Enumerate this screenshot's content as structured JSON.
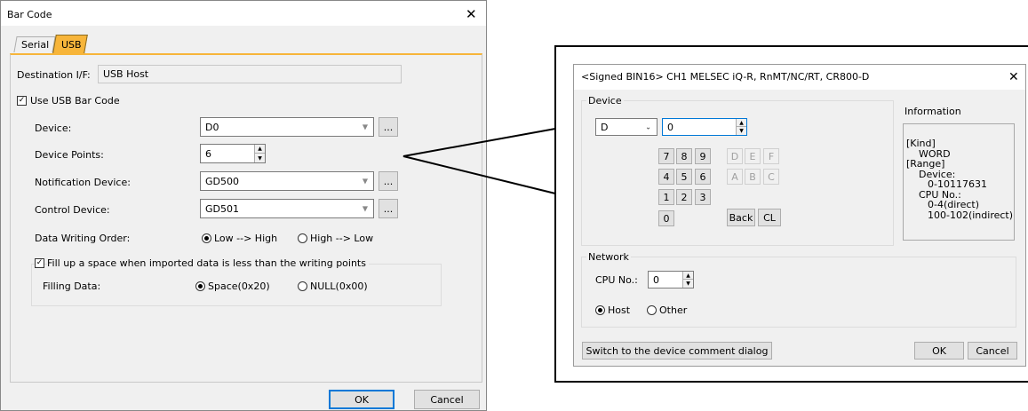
{
  "barcode_dialog": {
    "title": "Bar Code",
    "close_glyph": "✕",
    "tabs": [
      {
        "label": "Serial"
      },
      {
        "label": "USB"
      }
    ],
    "destination_label": "Destination I/F:",
    "destination_value": "USB Host",
    "use_usb_label": "Use USB Bar Code",
    "device_label": "Device:",
    "device_value": "D0",
    "device_points_label": "Device Points:",
    "device_points_value": "6",
    "notification_label": "Notification Device:",
    "notification_value": "GD500",
    "control_label": "Control Device:",
    "control_value": "GD501",
    "browse_label": "...",
    "order_label": "Data Writing Order:",
    "order_low_high": "Low --> High",
    "order_high_low": "High --> Low",
    "fill_label": "Fill up a space when imported data is less than the writing points",
    "filling_data_label": "Filling Data:",
    "fill_space": "Space(0x20)",
    "fill_null": "NULL(0x00)",
    "ok_label": "OK",
    "cancel_label": "Cancel"
  },
  "device_dialog": {
    "title": "<Signed BIN16> CH1 MELSEC iQ-R, RnMT/NC/RT, CR800-D",
    "close_glyph": "✕",
    "device_group": "Device",
    "device_type": "D",
    "device_number": "0",
    "keys_digits": [
      "7",
      "8",
      "9",
      "4",
      "5",
      "6",
      "1",
      "2",
      "3",
      "0"
    ],
    "keys_hex": [
      "D",
      "E",
      "F",
      "A",
      "B",
      "C"
    ],
    "back_label": "Back",
    "cl_label": "CL",
    "information_label": "Information",
    "info_lines": [
      "[Kind]",
      "WORD",
      "[Range]",
      "Device:",
      "0-10117631",
      "CPU No.:",
      "0-4(direct)",
      "100-102(indirect)"
    ],
    "network_group": "Network",
    "cpu_label": "CPU No.:",
    "cpu_value": "0",
    "host_label": "Host",
    "other_label": "Other",
    "switch_label": "Switch to the device comment dialog",
    "ok_label": "OK",
    "cancel_label": "Cancel"
  }
}
